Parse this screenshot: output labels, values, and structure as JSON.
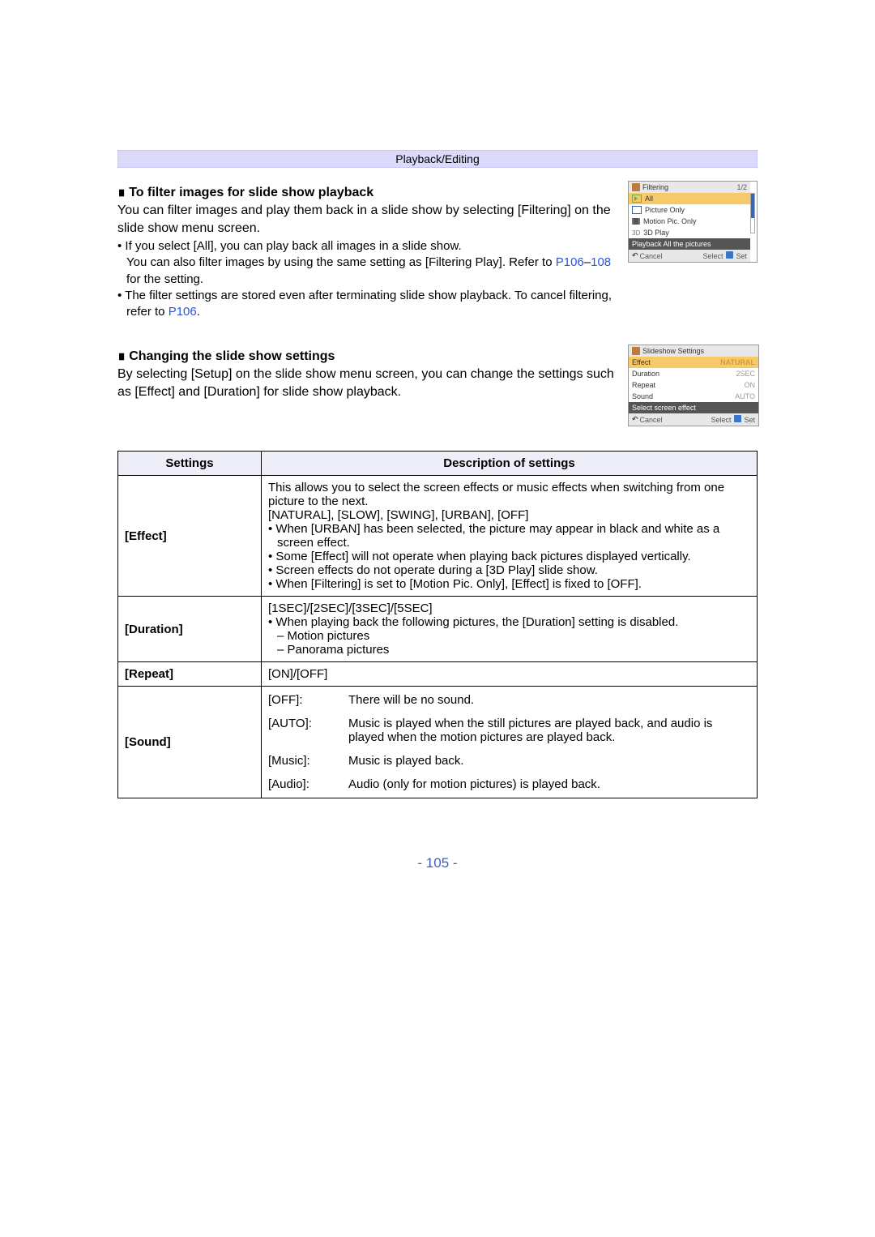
{
  "breadcrumb": "Playback/Editing",
  "sec1": {
    "heading": "To filter images for slide show playback",
    "body": "You can filter images and play them back in a slide show by selecting [Filtering] on the slide show menu screen.",
    "b1_a": "If you select [All], you can play back all images in a slide show.",
    "b1_b1": "You can also filter images by using the same setting as [Filtering Play]. Refer to ",
    "b1_link1": "P106",
    "b1_dash": "–",
    "b1_link2": "108",
    "b1_b2": " for the setting.",
    "b2_a": "The filter settings are stored even after terminating slide show playback. To cancel filtering, refer to ",
    "b2_link": "P106",
    "b2_b": "."
  },
  "cam1": {
    "title": "Filtering",
    "page": "1/2",
    "all": "All",
    "pic": "Picture Only",
    "mov": "Motion Pic. Only",
    "d3": "3D Play",
    "d3pre": "3D",
    "status": "Playback All the pictures",
    "cancel": "Cancel",
    "select": "Select",
    "set": "Set"
  },
  "sec2": {
    "heading": "Changing the slide show settings",
    "body": "By selecting [Setup] on the slide show menu screen, you can change the settings such as [Effect] and [Duration] for slide show playback."
  },
  "cam2": {
    "title": "Slideshow Settings",
    "effect": "Effect",
    "effect_v": "NATURAL",
    "duration": "Duration",
    "duration_v": "2SEC",
    "repeat": "Repeat",
    "repeat_v": "ON",
    "sound": "Sound",
    "sound_v": "AUTO",
    "status": "Select screen effect",
    "cancel": "Cancel",
    "select": "Select",
    "set": "Set"
  },
  "table": {
    "h1": "Settings",
    "h2": "Description of settings",
    "effect_label": "[Effect]",
    "effect_d1": "This allows you to select the screen effects or music effects when switching from one picture to the next.",
    "effect_d2": "[NATURAL], [SLOW], [SWING], [URBAN], [OFF]",
    "effect_b1": "When [URBAN] has been selected, the picture may appear in black and white as a screen effect.",
    "effect_b2": "Some [Effect] will not operate when playing back pictures displayed vertically.",
    "effect_b3": "Screen effects do not operate during a [3D Play] slide show.",
    "effect_b4": "When [Filtering] is set to [Motion Pic. Only], [Effect] is fixed to [OFF].",
    "duration_label": "[Duration]",
    "duration_d1": "[1SEC]/[2SEC]/[3SEC]/[5SEC]",
    "duration_b1": "When playing back the following pictures, the [Duration] setting is disabled.",
    "duration_s1": "Motion pictures",
    "duration_s2": "Panorama pictures",
    "repeat_label": "[Repeat]",
    "repeat_d": "[ON]/[OFF]",
    "sound_label": "[Sound]",
    "sound_off_k": "[OFF]:",
    "sound_off_v": "There will be no sound.",
    "sound_auto_k": "[AUTO]:",
    "sound_auto_v": "Music is played when the still pictures are played back, and audio is played when the motion pictures are played back.",
    "sound_music_k": "[Music]:",
    "sound_music_v": "Music is played back.",
    "sound_audio_k": "[Audio]:",
    "sound_audio_v": "Audio (only for motion pictures) is played back."
  },
  "page_number": "- 105 -"
}
